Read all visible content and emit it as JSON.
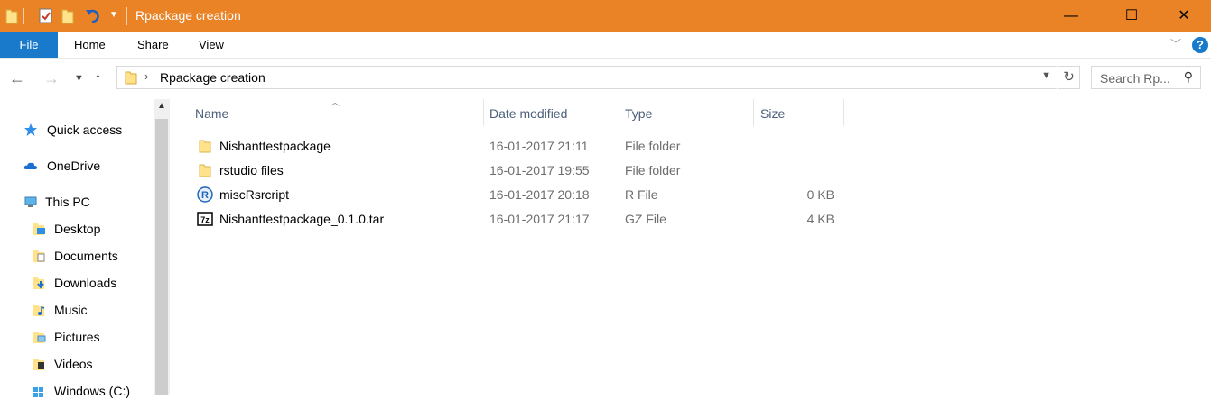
{
  "window": {
    "title": "Rpackage creation",
    "accent": "#ea8226",
    "controls": {
      "minimize": "—",
      "maximize": "☐",
      "close": "✕"
    }
  },
  "ribbon": {
    "file_tab": "File",
    "tabs": [
      "Home",
      "Share",
      "View"
    ],
    "help": "?"
  },
  "address": {
    "path": "Rpackage creation",
    "search_placeholder": "Search Rp..."
  },
  "nav": {
    "items": [
      {
        "label": "Quick access",
        "icon": "star-icon"
      },
      {
        "label": "OneDrive",
        "icon": "cloud-icon"
      },
      {
        "label": "This PC",
        "icon": "computer-icon"
      },
      {
        "label": "Desktop",
        "icon": "desktop-folder-icon"
      },
      {
        "label": "Documents",
        "icon": "documents-folder-icon"
      },
      {
        "label": "Downloads",
        "icon": "downloads-folder-icon"
      },
      {
        "label": "Music",
        "icon": "music-folder-icon"
      },
      {
        "label": "Pictures",
        "icon": "pictures-folder-icon"
      },
      {
        "label": "Videos",
        "icon": "videos-folder-icon"
      },
      {
        "label": "Windows (C:)",
        "icon": "drive-icon"
      }
    ]
  },
  "columns": {
    "name": "Name",
    "date": "Date modified",
    "type": "Type",
    "size": "Size"
  },
  "files": [
    {
      "name": "Nishanttestpackage",
      "date": "16-01-2017 21:11",
      "type": "File folder",
      "size": "",
      "icon": "folder-icon"
    },
    {
      "name": "rstudio files",
      "date": "16-01-2017 19:55",
      "type": "File folder",
      "size": "",
      "icon": "folder-icon"
    },
    {
      "name": "miscRsrcript",
      "date": "16-01-2017 20:18",
      "type": "R File",
      "size": "0 KB",
      "icon": "r-file-icon"
    },
    {
      "name": "Nishanttestpackage_0.1.0.tar",
      "date": "16-01-2017 21:17",
      "type": "GZ File",
      "size": "4 KB",
      "icon": "7z-archive-icon"
    }
  ]
}
